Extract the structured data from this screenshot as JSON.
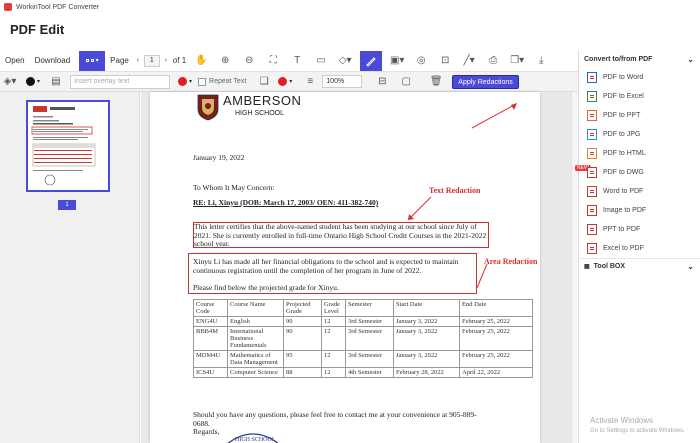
{
  "app": {
    "title": "WorkinTool PDF Converter",
    "page_title": "PDF Edit"
  },
  "toolbar": {
    "open": "Open",
    "download": "Download",
    "page_label": "Page",
    "page_current": "1",
    "page_total": "of 1"
  },
  "redaction_bar": {
    "overlay_placeholder": "Insert overlay text",
    "repeat_text": "Repeat Text",
    "zoom": "100%",
    "apply": "Apply Redactions"
  },
  "thumbnail": {
    "page_number": "1"
  },
  "document": {
    "school_name": "AMBERSON",
    "school_sub": "HIGH SCHOOL",
    "date": "January 19, 2022",
    "salutation": "To Whom It May Concern:",
    "re_line": "RE: Li, Xinyu (DOB: March 17, 2003/ OEN: 411-382-740)",
    "para1_line1": "This letter certifies that the above-named student has been studying at our school since July of",
    "para1_line2": "2021. She is currently enrolled in full-time Ontario High School Credit Courses in the 2021-2022",
    "para1_line3": "school year.",
    "para2_line1": "Xinyu Li has made all her financial obligations to the school and is expected to maintain",
    "para2_line2": "continuous registration until the completion of her program in June of 2022.",
    "para3": "Please find below the projected grade for Xinyu.",
    "table": {
      "headers": [
        "Course Code",
        "Course Name",
        "Projected Grade",
        "Grade Level",
        "Semester",
        "Start Date",
        "End Date"
      ],
      "rows": [
        [
          "ENG4U",
          "English",
          "90",
          "12",
          "3rd Semester",
          "January 3, 2022",
          "February 25, 2022"
        ],
        [
          "BBB4M",
          "International Business Fundamentals",
          "90",
          "12",
          "3rd Semester",
          "January 3, 2022",
          "February 25, 2022"
        ],
        [
          "MDM4U",
          "Mathematics of Data Management",
          "95",
          "12",
          "3rd Semester",
          "January 3, 2022",
          "February 25, 2022"
        ],
        [
          "ICS4U",
          "Computer Science",
          "88",
          "12",
          "4th Semester",
          "February 28, 2022",
          "April 22, 2022"
        ]
      ]
    },
    "closing_line1": "Should you have any questions, please feel free to contact me at your convenience at 905-889-",
    "closing_line2": "0688.",
    "regards": "Regards,",
    "seal_text": "HIGH SCHOOL"
  },
  "annotations": {
    "text_redaction": "Text Redaction",
    "area_redaction": "Area Redaction"
  },
  "right_panel": {
    "convert_header": "Convert to/from PDF",
    "items": [
      "PDF to Word",
      "PDF to Excel",
      "PDF to PPT",
      "PDF to JPG",
      "PDF to HTML",
      "PDF to DWG",
      "Word to PDF",
      "Image to PDF",
      "PPT to PDF",
      "Excel to PDF"
    ],
    "new_badge": "NEW",
    "toolbox_header": "Tool BOX"
  },
  "watermark": {
    "line1": "Activate Windows",
    "line2": "Go to Settings to activate Windows."
  },
  "colors": {
    "accent": "#4b4ad6",
    "redaction": "#d63030"
  }
}
